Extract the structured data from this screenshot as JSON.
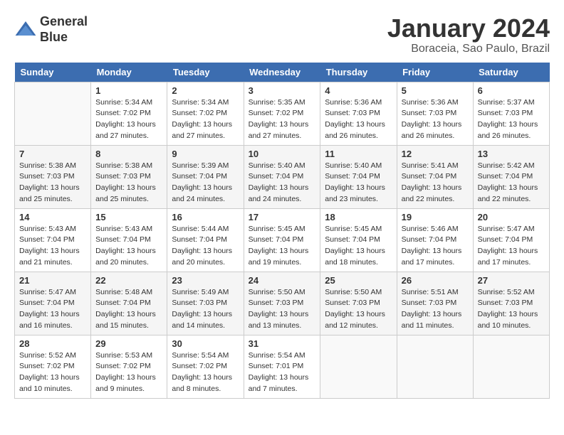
{
  "header": {
    "logo_line1": "General",
    "logo_line2": "Blue",
    "month_title": "January 2024",
    "location": "Boraceia, Sao Paulo, Brazil"
  },
  "weekdays": [
    "Sunday",
    "Monday",
    "Tuesday",
    "Wednesday",
    "Thursday",
    "Friday",
    "Saturday"
  ],
  "weeks": [
    [
      {
        "day": "",
        "sunrise": "",
        "sunset": "",
        "daylight": ""
      },
      {
        "day": "1",
        "sunrise": "Sunrise: 5:34 AM",
        "sunset": "Sunset: 7:02 PM",
        "daylight": "Daylight: 13 hours and 27 minutes."
      },
      {
        "day": "2",
        "sunrise": "Sunrise: 5:34 AM",
        "sunset": "Sunset: 7:02 PM",
        "daylight": "Daylight: 13 hours and 27 minutes."
      },
      {
        "day": "3",
        "sunrise": "Sunrise: 5:35 AM",
        "sunset": "Sunset: 7:02 PM",
        "daylight": "Daylight: 13 hours and 27 minutes."
      },
      {
        "day": "4",
        "sunrise": "Sunrise: 5:36 AM",
        "sunset": "Sunset: 7:03 PM",
        "daylight": "Daylight: 13 hours and 26 minutes."
      },
      {
        "day": "5",
        "sunrise": "Sunrise: 5:36 AM",
        "sunset": "Sunset: 7:03 PM",
        "daylight": "Daylight: 13 hours and 26 minutes."
      },
      {
        "day": "6",
        "sunrise": "Sunrise: 5:37 AM",
        "sunset": "Sunset: 7:03 PM",
        "daylight": "Daylight: 13 hours and 26 minutes."
      }
    ],
    [
      {
        "day": "7",
        "sunrise": "Sunrise: 5:38 AM",
        "sunset": "Sunset: 7:03 PM",
        "daylight": "Daylight: 13 hours and 25 minutes."
      },
      {
        "day": "8",
        "sunrise": "Sunrise: 5:38 AM",
        "sunset": "Sunset: 7:03 PM",
        "daylight": "Daylight: 13 hours and 25 minutes."
      },
      {
        "day": "9",
        "sunrise": "Sunrise: 5:39 AM",
        "sunset": "Sunset: 7:04 PM",
        "daylight": "Daylight: 13 hours and 24 minutes."
      },
      {
        "day": "10",
        "sunrise": "Sunrise: 5:40 AM",
        "sunset": "Sunset: 7:04 PM",
        "daylight": "Daylight: 13 hours and 24 minutes."
      },
      {
        "day": "11",
        "sunrise": "Sunrise: 5:40 AM",
        "sunset": "Sunset: 7:04 PM",
        "daylight": "Daylight: 13 hours and 23 minutes."
      },
      {
        "day": "12",
        "sunrise": "Sunrise: 5:41 AM",
        "sunset": "Sunset: 7:04 PM",
        "daylight": "Daylight: 13 hours and 22 minutes."
      },
      {
        "day": "13",
        "sunrise": "Sunrise: 5:42 AM",
        "sunset": "Sunset: 7:04 PM",
        "daylight": "Daylight: 13 hours and 22 minutes."
      }
    ],
    [
      {
        "day": "14",
        "sunrise": "Sunrise: 5:43 AM",
        "sunset": "Sunset: 7:04 PM",
        "daylight": "Daylight: 13 hours and 21 minutes."
      },
      {
        "day": "15",
        "sunrise": "Sunrise: 5:43 AM",
        "sunset": "Sunset: 7:04 PM",
        "daylight": "Daylight: 13 hours and 20 minutes."
      },
      {
        "day": "16",
        "sunrise": "Sunrise: 5:44 AM",
        "sunset": "Sunset: 7:04 PM",
        "daylight": "Daylight: 13 hours and 20 minutes."
      },
      {
        "day": "17",
        "sunrise": "Sunrise: 5:45 AM",
        "sunset": "Sunset: 7:04 PM",
        "daylight": "Daylight: 13 hours and 19 minutes."
      },
      {
        "day": "18",
        "sunrise": "Sunrise: 5:45 AM",
        "sunset": "Sunset: 7:04 PM",
        "daylight": "Daylight: 13 hours and 18 minutes."
      },
      {
        "day": "19",
        "sunrise": "Sunrise: 5:46 AM",
        "sunset": "Sunset: 7:04 PM",
        "daylight": "Daylight: 13 hours and 17 minutes."
      },
      {
        "day": "20",
        "sunrise": "Sunrise: 5:47 AM",
        "sunset": "Sunset: 7:04 PM",
        "daylight": "Daylight: 13 hours and 17 minutes."
      }
    ],
    [
      {
        "day": "21",
        "sunrise": "Sunrise: 5:47 AM",
        "sunset": "Sunset: 7:04 PM",
        "daylight": "Daylight: 13 hours and 16 minutes."
      },
      {
        "day": "22",
        "sunrise": "Sunrise: 5:48 AM",
        "sunset": "Sunset: 7:04 PM",
        "daylight": "Daylight: 13 hours and 15 minutes."
      },
      {
        "day": "23",
        "sunrise": "Sunrise: 5:49 AM",
        "sunset": "Sunset: 7:03 PM",
        "daylight": "Daylight: 13 hours and 14 minutes."
      },
      {
        "day": "24",
        "sunrise": "Sunrise: 5:50 AM",
        "sunset": "Sunset: 7:03 PM",
        "daylight": "Daylight: 13 hours and 13 minutes."
      },
      {
        "day": "25",
        "sunrise": "Sunrise: 5:50 AM",
        "sunset": "Sunset: 7:03 PM",
        "daylight": "Daylight: 13 hours and 12 minutes."
      },
      {
        "day": "26",
        "sunrise": "Sunrise: 5:51 AM",
        "sunset": "Sunset: 7:03 PM",
        "daylight": "Daylight: 13 hours and 11 minutes."
      },
      {
        "day": "27",
        "sunrise": "Sunrise: 5:52 AM",
        "sunset": "Sunset: 7:03 PM",
        "daylight": "Daylight: 13 hours and 10 minutes."
      }
    ],
    [
      {
        "day": "28",
        "sunrise": "Sunrise: 5:52 AM",
        "sunset": "Sunset: 7:02 PM",
        "daylight": "Daylight: 13 hours and 10 minutes."
      },
      {
        "day": "29",
        "sunrise": "Sunrise: 5:53 AM",
        "sunset": "Sunset: 7:02 PM",
        "daylight": "Daylight: 13 hours and 9 minutes."
      },
      {
        "day": "30",
        "sunrise": "Sunrise: 5:54 AM",
        "sunset": "Sunset: 7:02 PM",
        "daylight": "Daylight: 13 hours and 8 minutes."
      },
      {
        "day": "31",
        "sunrise": "Sunrise: 5:54 AM",
        "sunset": "Sunset: 7:01 PM",
        "daylight": "Daylight: 13 hours and 7 minutes."
      },
      {
        "day": "",
        "sunrise": "",
        "sunset": "",
        "daylight": ""
      },
      {
        "day": "",
        "sunrise": "",
        "sunset": "",
        "daylight": ""
      },
      {
        "day": "",
        "sunrise": "",
        "sunset": "",
        "daylight": ""
      }
    ]
  ]
}
